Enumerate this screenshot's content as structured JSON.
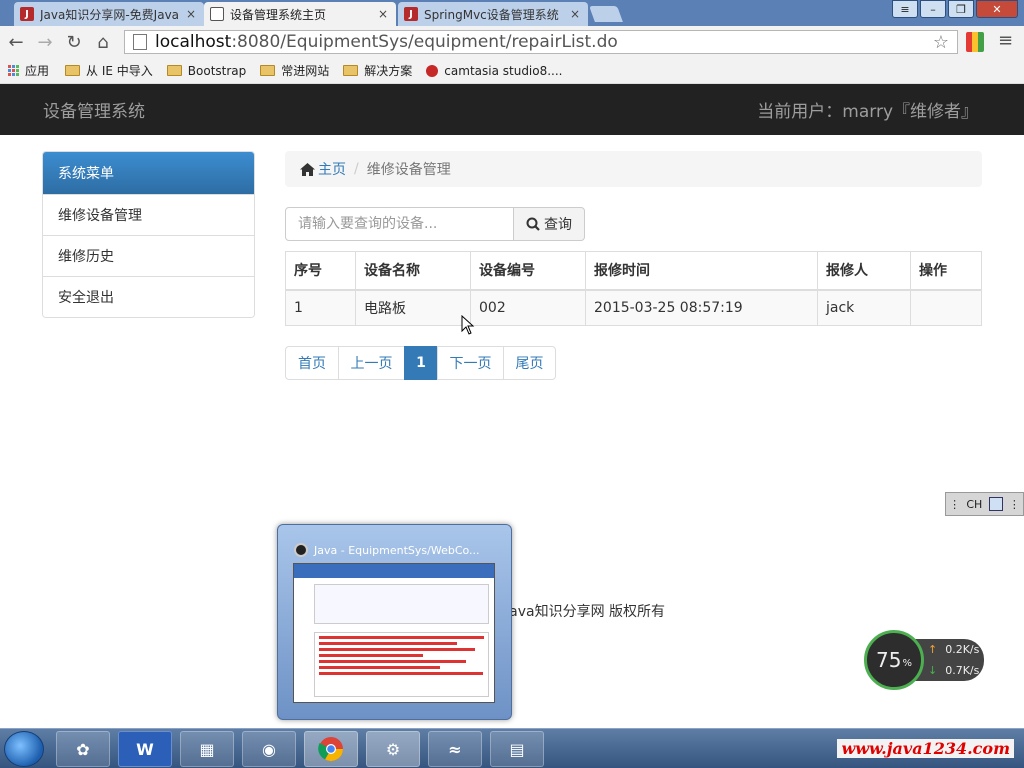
{
  "browser": {
    "tabs": [
      {
        "title": "Java知识分享网-免费Java",
        "active": false
      },
      {
        "title": "设备管理系统主页",
        "active": true
      },
      {
        "title": "SpringMvc设备管理系统",
        "active": false
      }
    ],
    "close_glyph": "×",
    "window_buttons": [
      "≡",
      "–",
      "❐",
      "✕"
    ],
    "address": {
      "host": "localhost",
      "path": ":8080/EquipmentSys/equipment/repairList.do"
    },
    "bookmarks": [
      "应用",
      "从 IE 中导入",
      "Bootstrap",
      "常进网站",
      "解决方案",
      "camtasia studio8...."
    ]
  },
  "app": {
    "brand": "设备管理系统",
    "current_user": "当前用户：marry『维修者』",
    "menu": {
      "heading": "系统菜单",
      "items": [
        "维修设备管理",
        "维修历史",
        "安全退出"
      ]
    },
    "breadcrumb": {
      "home": "主页",
      "separator": "/",
      "current": "维修设备管理"
    },
    "search": {
      "placeholder": "请输入要查询的设备...",
      "button": "查询"
    },
    "table": {
      "headers": [
        "序号",
        "设备名称",
        "设备编号",
        "报修时间",
        "报修人",
        "操作"
      ],
      "rows": [
        [
          "1",
          "电路板",
          "002",
          "2015-03-25 08:57:19",
          "jack",
          ""
        ]
      ]
    },
    "pager": [
      "首页",
      "上一页",
      "1",
      "下一页",
      "尾页"
    ],
    "footer": "Java知识分享网 版权所有"
  },
  "overlay": {
    "preview_title": "Java - EquipmentSys/WebCo...",
    "speed": {
      "percent": "75",
      "percent_sign": "%",
      "up": "0.2K/s",
      "down": "0.7K/s"
    },
    "ime": "CH",
    "watermark": "www.java1234.com"
  },
  "colors": {
    "primary": "#337ab7",
    "navbar": "#222222",
    "tabstrip": "#5a80b5"
  }
}
